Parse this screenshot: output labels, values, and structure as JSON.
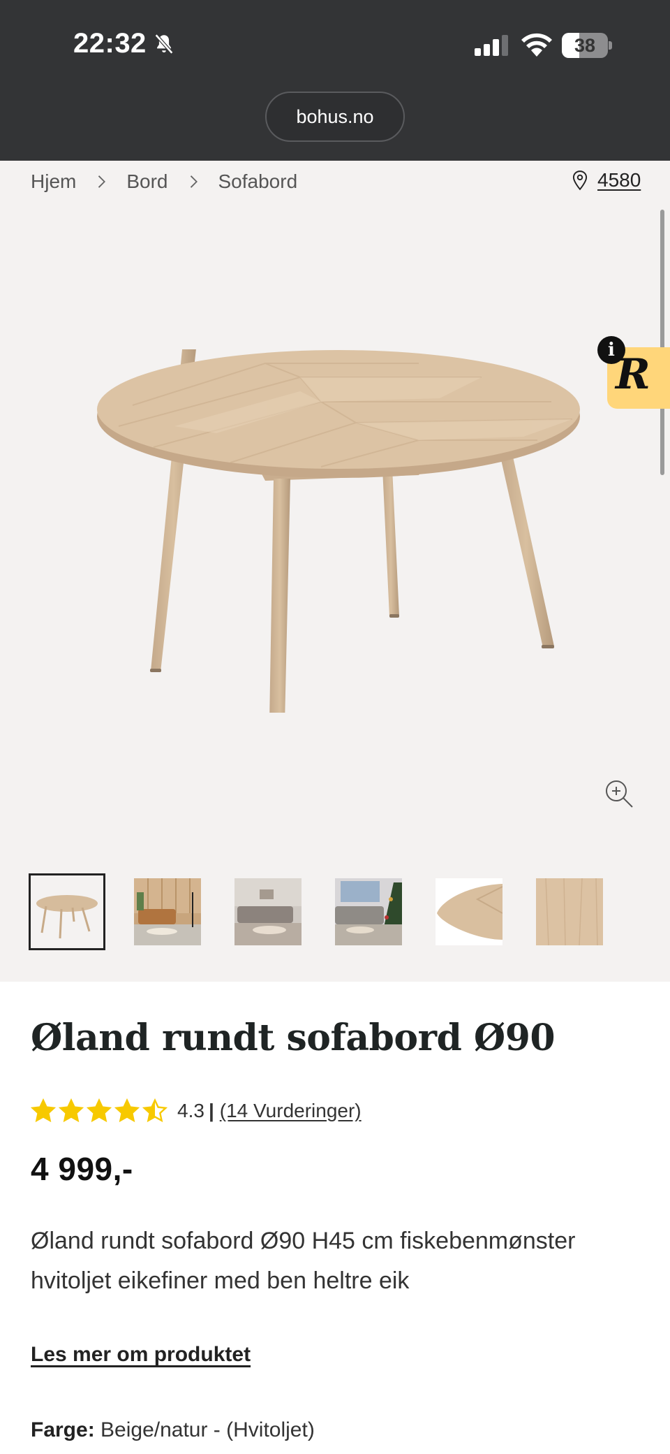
{
  "status_bar": {
    "time": "22:32",
    "battery": "38",
    "battery_level": 0.38
  },
  "browser": {
    "url": "bohus.no"
  },
  "breadcrumb": {
    "items": [
      "Hjem",
      "Bord",
      "Sofabord"
    ]
  },
  "store": {
    "number": "4580"
  },
  "gallery": {
    "thumbnail_count": 6,
    "selected_index": 0
  },
  "badge": {
    "letter": "R",
    "info": "i"
  },
  "product": {
    "title": "Øland rundt sofabord Ø90",
    "rating_value": 4.3,
    "rating_text": "4.3",
    "rating_separator": "|",
    "reviews": "(14 Vurderinger)",
    "price": "4 999,-",
    "description": "Øland rundt sofabord Ø90 H45 cm fiskebenmønster hvitoljet eikefiner med ben heltre eik",
    "read_more": "Les mer om produktet",
    "color_label": "Farge:",
    "color_value": "Beige/natur - (Hvitoljet)"
  },
  "colors": {
    "star": "#f7c900",
    "topbar": "#333436",
    "gallery_bg": "#f4f2f1",
    "badge": "#ffd67a"
  }
}
